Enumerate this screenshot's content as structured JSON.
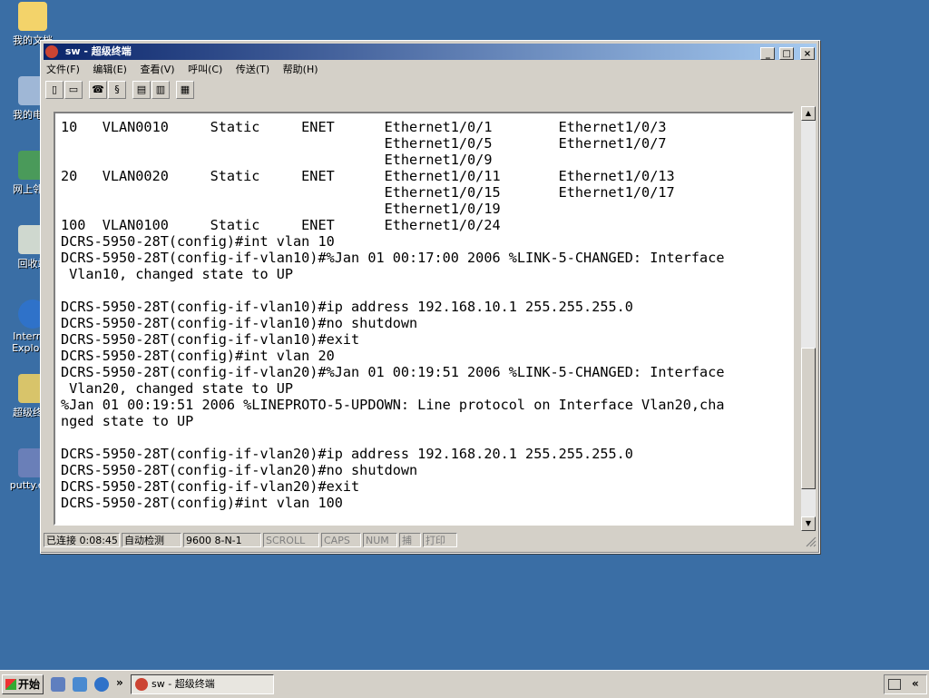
{
  "desktop": {
    "icons": [
      {
        "label": "我的文档"
      },
      {
        "label": "我的电脑"
      },
      {
        "label": "网上邻居"
      },
      {
        "label": "回收站"
      },
      {
        "label": "Internet Explorer"
      },
      {
        "label": "超级终端"
      },
      {
        "label": "putty.exe"
      }
    ]
  },
  "window": {
    "title": "sw - 超级终端",
    "buttons": {
      "minimize": "_",
      "maximize": "□",
      "close": "×"
    }
  },
  "menubar": [
    "文件(F)",
    "编辑(E)",
    "查看(V)",
    "呼叫(C)",
    "传送(T)",
    "帮助(H)"
  ],
  "toolbar": {
    "icons": [
      "new-icon",
      "open-icon",
      "disconnect-icon",
      "dial-icon",
      "send-icon",
      "receive-icon",
      "properties-icon"
    ]
  },
  "terminal": {
    "lines": [
      "10   VLAN0010     Static     ENET      Ethernet1/0/1        Ethernet1/0/3",
      "                                       Ethernet1/0/5        Ethernet1/0/7",
      "                                       Ethernet1/0/9",
      "20   VLAN0020     Static     ENET      Ethernet1/0/11       Ethernet1/0/13",
      "                                       Ethernet1/0/15       Ethernet1/0/17",
      "                                       Ethernet1/0/19",
      "100  VLAN0100     Static     ENET      Ethernet1/0/24",
      "DCRS-5950-28T(config)#int vlan 10",
      "DCRS-5950-28T(config-if-vlan10)#%Jan 01 00:17:00 2006 %LINK-5-CHANGED: Interface",
      " Vlan10, changed state to UP",
      "",
      "DCRS-5950-28T(config-if-vlan10)#ip address 192.168.10.1 255.255.255.0",
      "DCRS-5950-28T(config-if-vlan10)#no shutdown",
      "DCRS-5950-28T(config-if-vlan10)#exit",
      "DCRS-5950-28T(config)#int vlan 20",
      "DCRS-5950-28T(config-if-vlan20)#%Jan 01 00:19:51 2006 %LINK-5-CHANGED: Interface",
      " Vlan20, changed state to UP",
      "%Jan 01 00:19:51 2006 %LINEPROTO-5-UPDOWN: Line protocol on Interface Vlan20,cha",
      "nged state to UP",
      "",
      "DCRS-5950-28T(config-if-vlan20)#ip address 192.168.20.1 255.255.255.0",
      "DCRS-5950-28T(config-if-vlan20)#no shutdown",
      "DCRS-5950-28T(config-if-vlan20)#exit",
      "DCRS-5950-28T(config)#int vlan 100"
    ]
  },
  "statusbar": {
    "connected": "已连接 0:08:45",
    "detect": "自动检测",
    "port": "9600 8-N-1",
    "scroll": "SCROLL",
    "caps": "CAPS",
    "num": "NUM",
    "capture": "捕",
    "print": "打印"
  },
  "taskbar": {
    "start": "开始",
    "more": "»",
    "task_title": "sw - 超级终端",
    "tray_more": "«"
  }
}
